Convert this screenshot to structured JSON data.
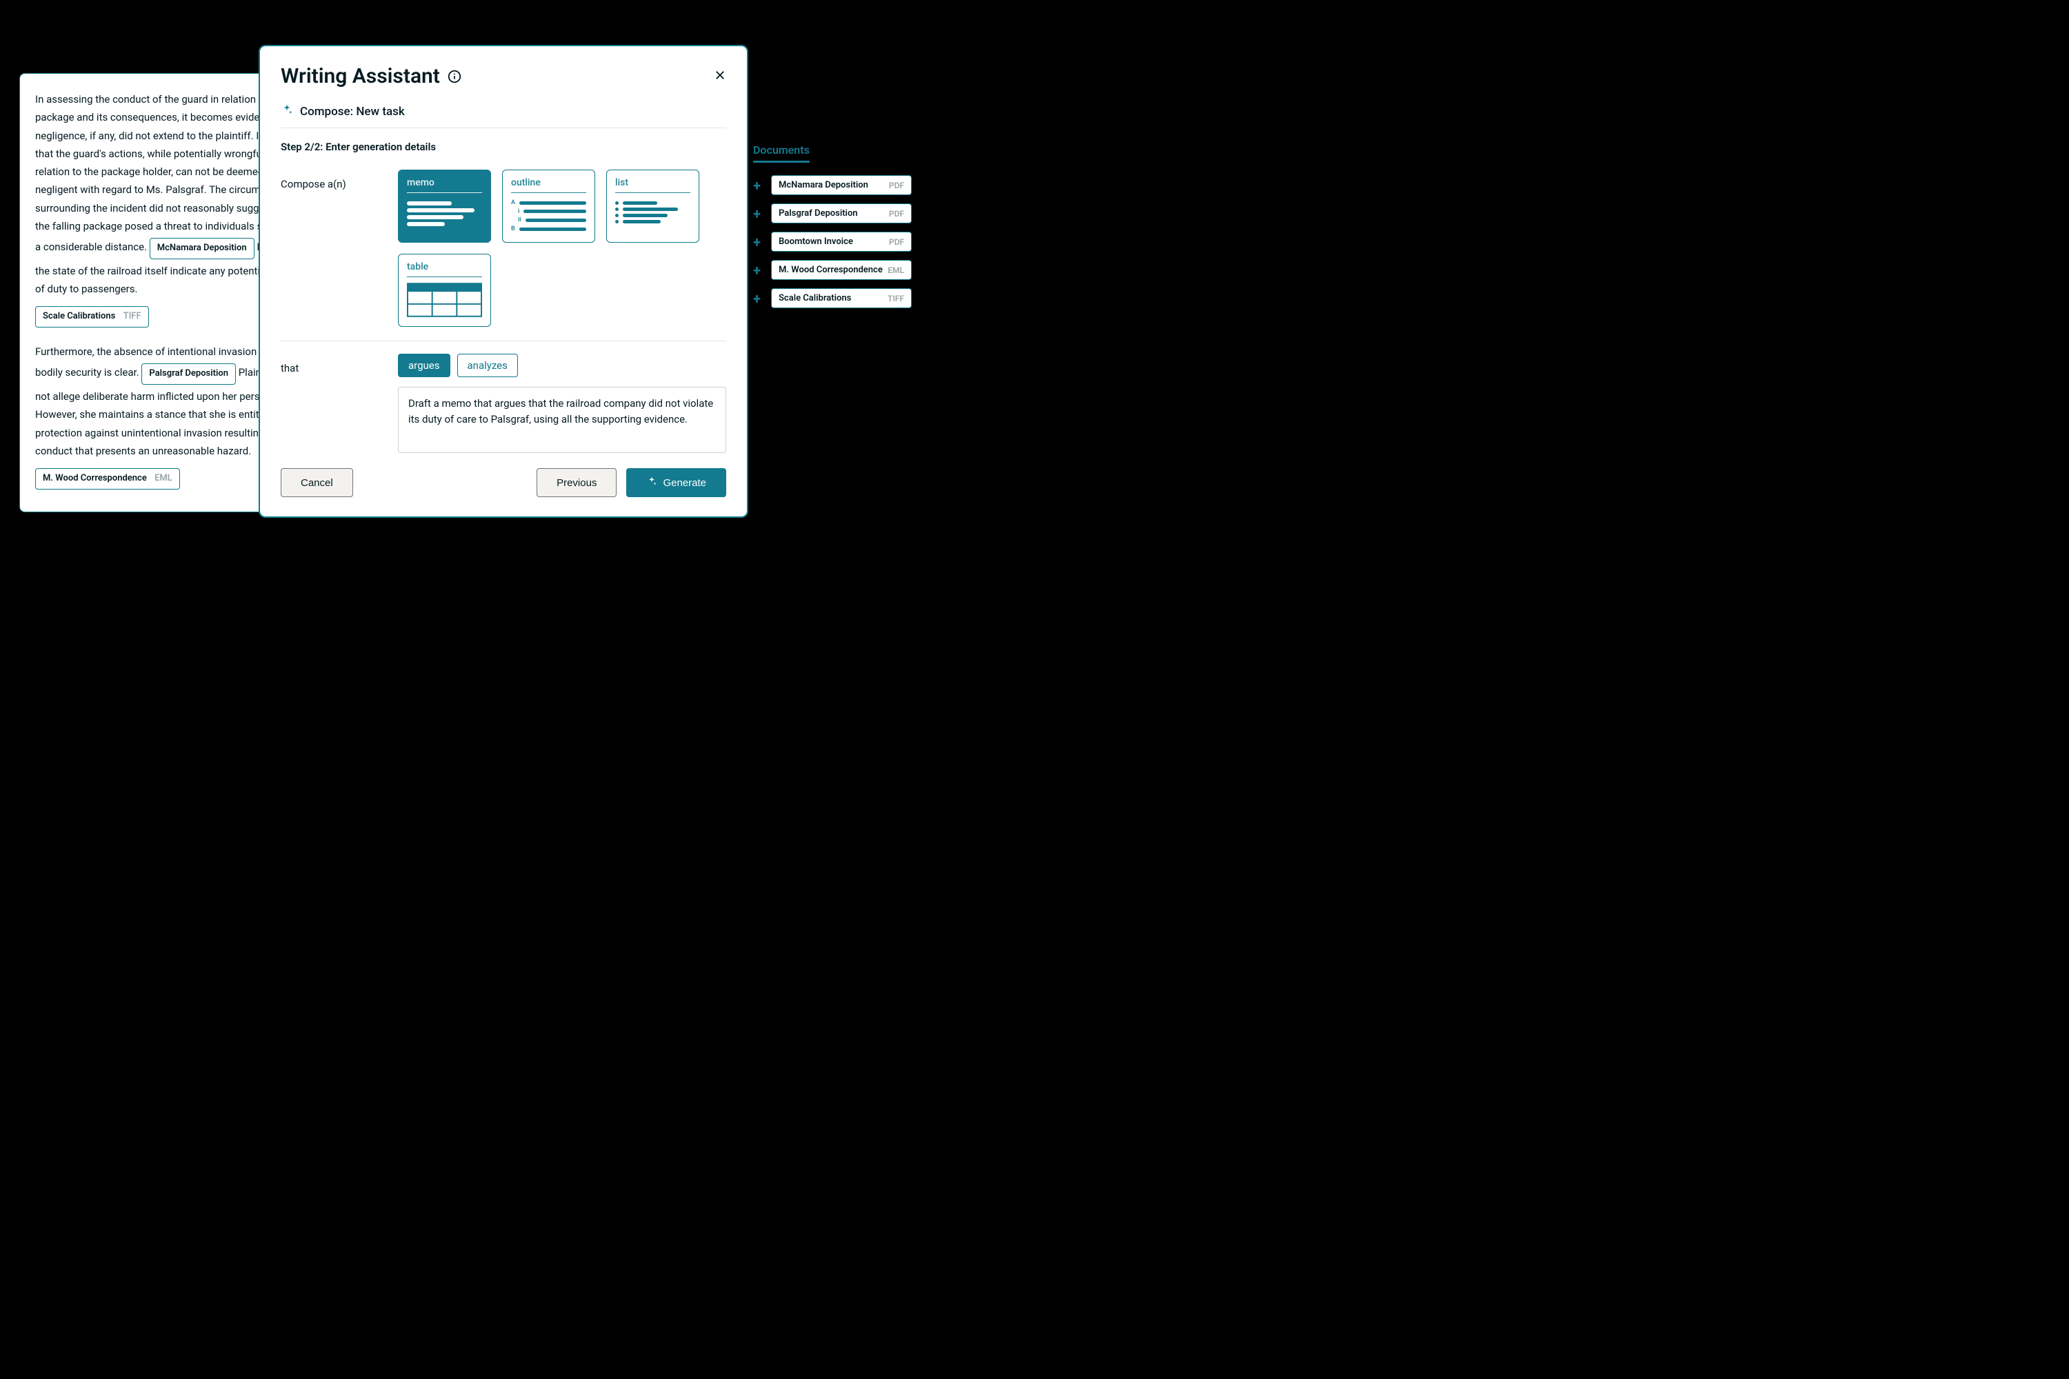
{
  "doc_card": {
    "p1_a": "In assessing the conduct of the guard in relation to the package and its consequences, it becomes evident that negligence, if any, did not extend to the plaintiff. It is clear that the guard's actions, while potentially wrongful in relation to the package holder, can not be deemed negligent with regard to Ms. Palsgraf. The circumstances surrounding the incident did not reasonably suggest that the falling package posed a threat to individuals situated at a considerable distance.",
    "chip1_name": "McNamara Deposition",
    "p1_b": "Nor does the state of the railroad itself indicate any potential breach of duty to passengers.",
    "chip2_name": "Scale Calibrations",
    "chip2_ext": "TIFF",
    "p2_a": "Furthermore, the absence of intentional invasion of her bodily security is clear.",
    "chip3_name": "Palsgraf Deposition",
    "p2_b": "Plaintiff does not allege deliberate harm inflicted upon her person. However, she maintains a stance that she is entitled to protection against unintentional invasion resulting from conduct that presents an unreasonable hazard.",
    "chip4_name": "M. Wood Correspondence",
    "chip4_ext": "EML"
  },
  "modal": {
    "title": "Writing Assistant",
    "compose_label": "Compose: New task",
    "step_label": "Step 2/2: Enter generation details",
    "compose_prompt": "Compose a(n)",
    "types": {
      "memo": "memo",
      "outline": "outline",
      "list": "list",
      "table": "table"
    },
    "that_label": "that",
    "verbs": {
      "argues": "argues",
      "analyzes": "analyzes"
    },
    "prompt_text": "Draft a memo that argues that the railroad company did not violate its duty of care to Palsgraf, using all the supporting evidence.",
    "cancel": "Cancel",
    "previous": "Previous",
    "generate": "Generate"
  },
  "docs_panel": {
    "title": "Documents",
    "items": [
      {
        "name": "McNamara Deposition",
        "ext": "PDF"
      },
      {
        "name": "Palsgraf Deposition",
        "ext": "PDF"
      },
      {
        "name": "Boomtown Invoice",
        "ext": "PDF"
      },
      {
        "name": "M. Wood Correspondence",
        "ext": "EML"
      },
      {
        "name": "Scale Calibrations",
        "ext": "TIFF"
      }
    ]
  }
}
